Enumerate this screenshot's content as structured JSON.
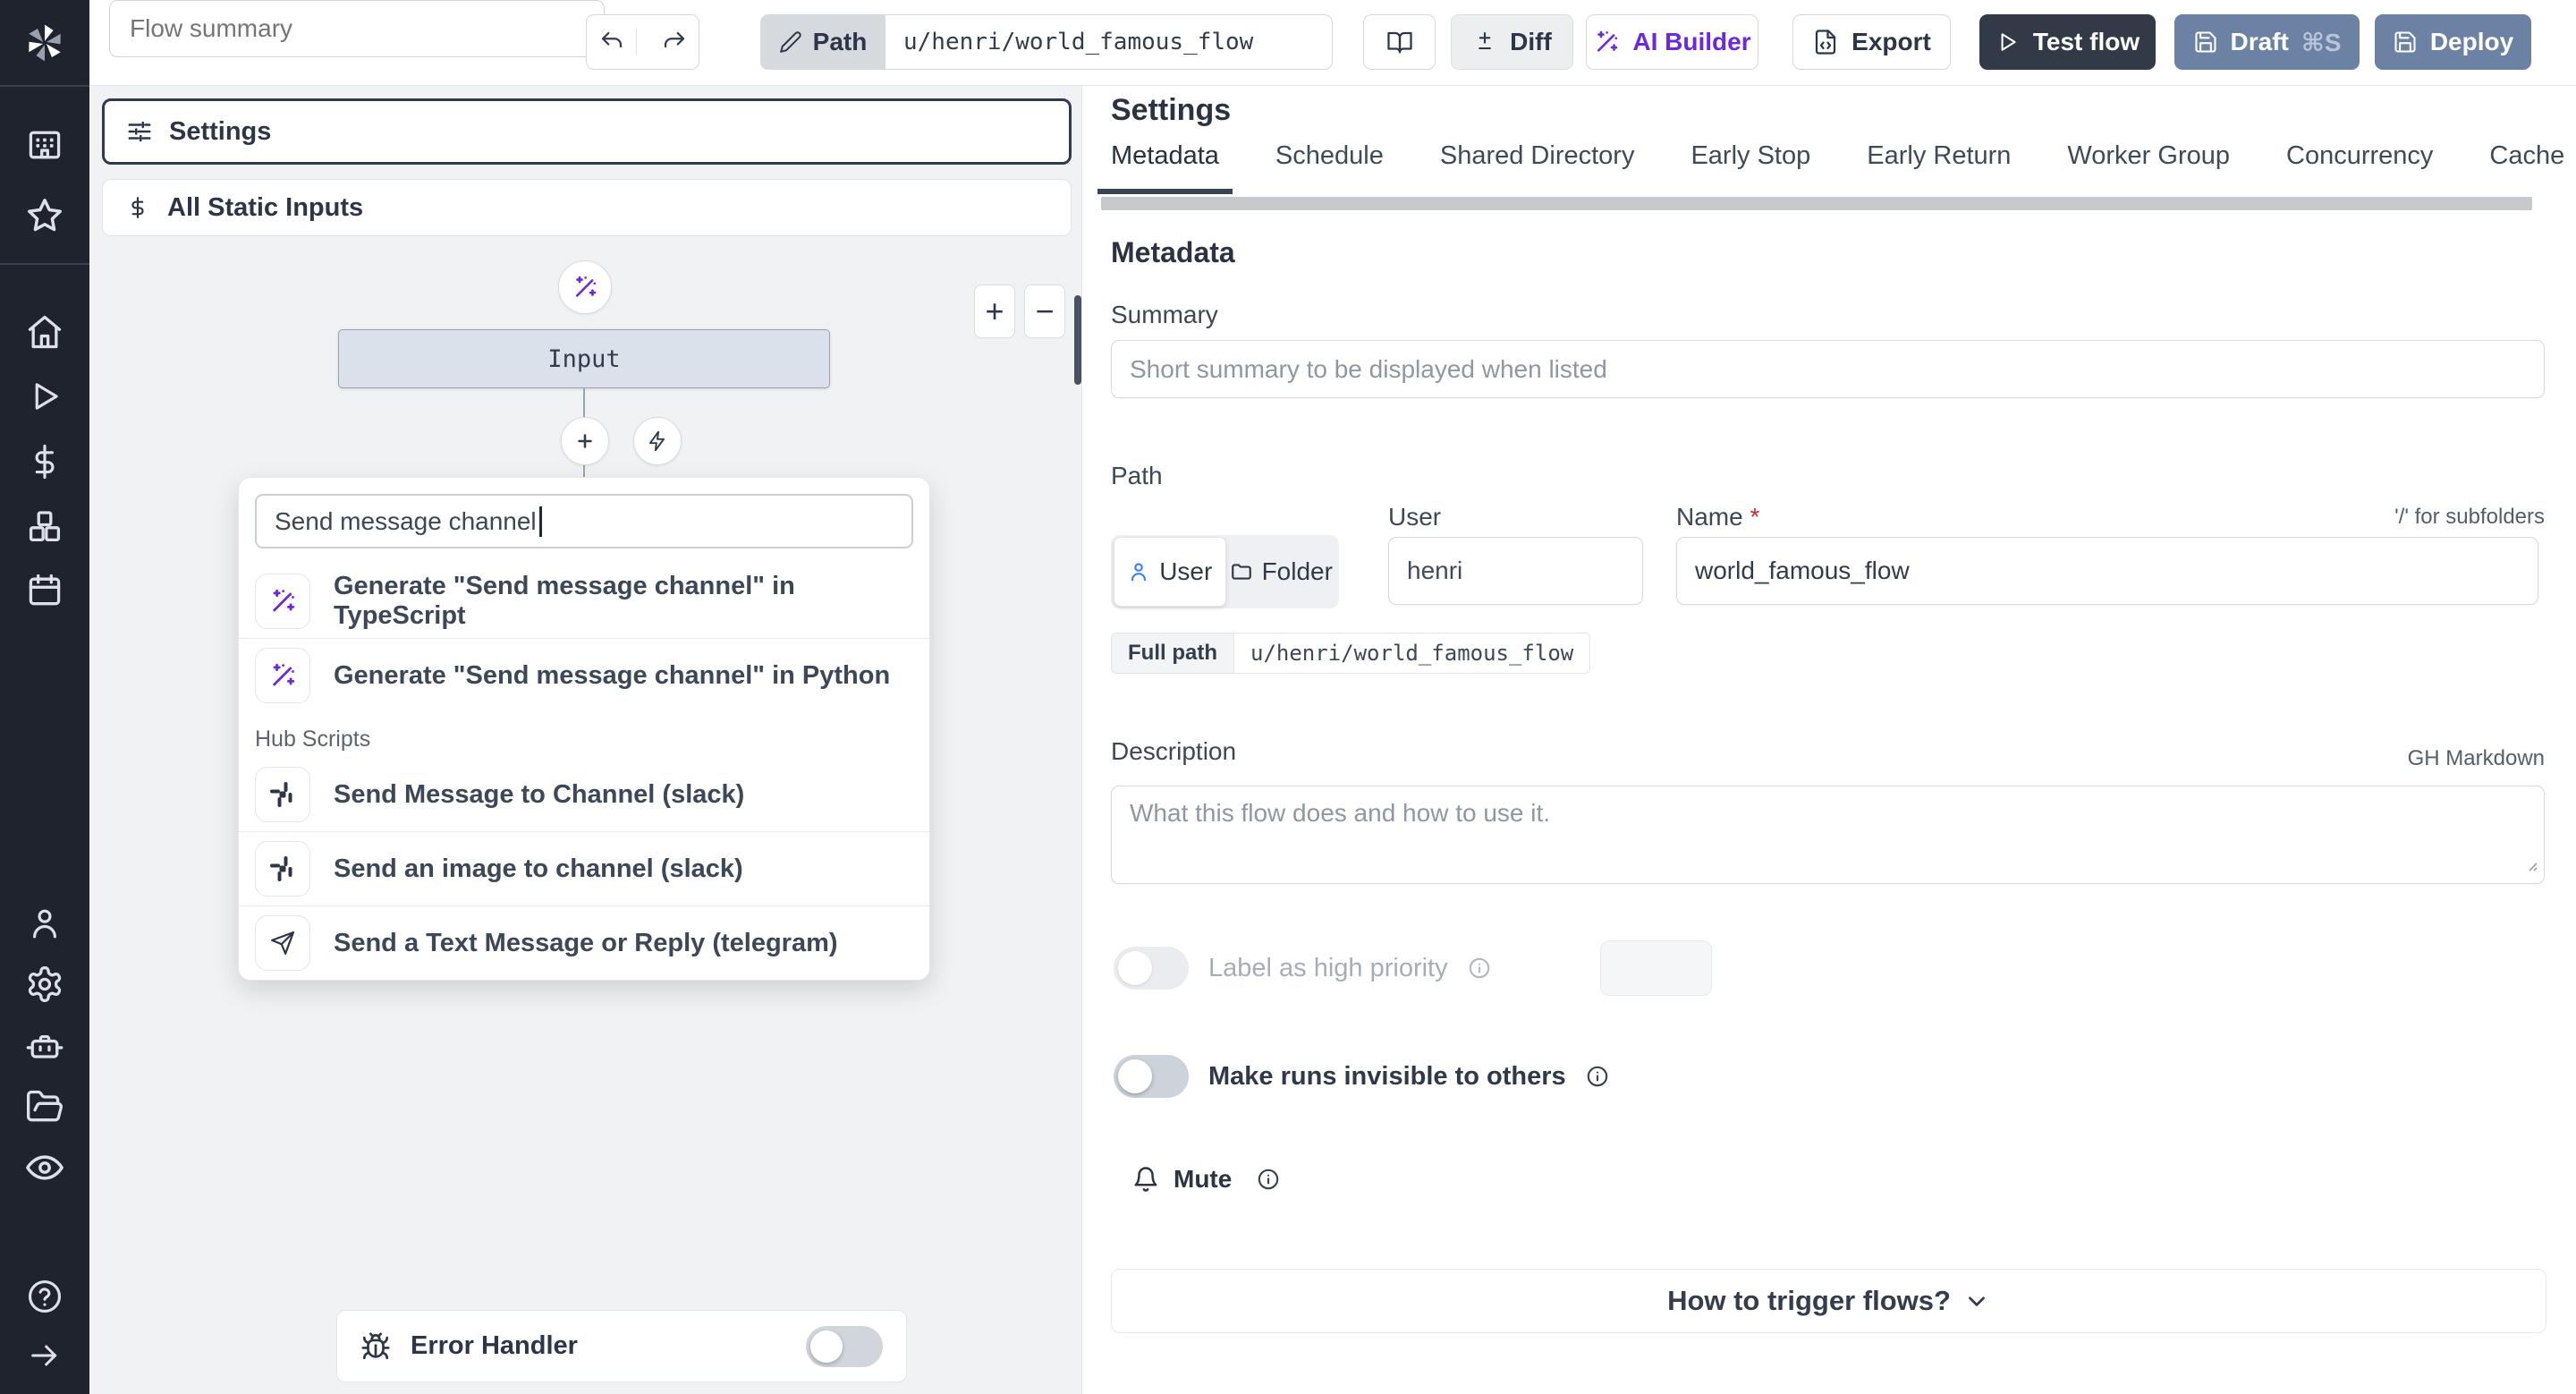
{
  "topbar": {
    "flow_summary_placeholder": "Flow summary",
    "path_label": "Path",
    "path_value": "u/henri/world_famous_flow",
    "diff_label": "Diff",
    "ai_builder_label": "AI Builder",
    "export_label": "Export",
    "test_flow_label": "Test flow",
    "draft_label": "Draft",
    "draft_shortcut": "⌘S",
    "deploy_label": "Deploy"
  },
  "sidebar": {
    "icons": [
      "windmill-logo",
      "workspace",
      "favorites",
      "home",
      "runs",
      "variables",
      "resources",
      "schedules",
      "users",
      "settings",
      "workers",
      "folders",
      "audit-logs",
      "help",
      "expand"
    ]
  },
  "flow_editor": {
    "settings_label": "Settings",
    "static_inputs_label": "All Static Inputs",
    "input_node_label": "Input",
    "zoom_in_label": "+",
    "zoom_out_label": "−",
    "search_value": "Send message channel",
    "suggestions": [
      {
        "icon": "wand-icon",
        "label": "Generate \"Send message channel\" in TypeScript"
      },
      {
        "icon": "wand-icon",
        "label": "Generate \"Send message channel\" in Python"
      }
    ],
    "hub_scripts_label": "Hub Scripts",
    "hub_scripts": [
      {
        "icon": "slack-icon",
        "label": "Send Message to Channel (slack)"
      },
      {
        "icon": "slack-icon",
        "label": "Send an image to channel (slack)"
      },
      {
        "icon": "telegram-icon",
        "label": "Send a Text Message or Reply (telegram)"
      }
    ],
    "error_handler_label": "Error Handler"
  },
  "settings_panel": {
    "title": "Settings",
    "tabs": [
      "Metadata",
      "Schedule",
      "Shared Directory",
      "Early Stop",
      "Early Return",
      "Worker Group",
      "Concurrency",
      "Cache"
    ],
    "active_tab": "Metadata",
    "metadata": {
      "heading": "Metadata",
      "summary_label": "Summary",
      "summary_placeholder": "Short summary to be displayed when listed",
      "path_label": "Path",
      "owner_user_label": "User",
      "owner_folder_label": "Folder",
      "user_label": "User",
      "user_value": "henri",
      "name_label": "Name",
      "name_required_mark": "*",
      "name_value": "world_famous_flow",
      "subfolder_hint": "'/' for subfolders",
      "full_path_label": "Full path",
      "full_path_value": "u/henri/world_famous_flow",
      "description_label": "Description",
      "markdown_hint": "GH Markdown",
      "description_placeholder": "What this flow does and how to use it.",
      "high_priority_label": "Label as high priority",
      "invisible_runs_label": "Make runs invisible to others",
      "mute_label": "Mute",
      "trigger_label": "How to trigger flows?"
    }
  },
  "colors": {
    "sidebar_bg": "#1e232e",
    "accent_purple": "#6d28d9",
    "slate_button": "#6c82a4",
    "dark_button": "#323a47",
    "panel_bg": "#f1f2f4",
    "active_tab_underline": "#394357",
    "required_red": "#dc2626",
    "user_icon_blue": "#3b82f6"
  }
}
